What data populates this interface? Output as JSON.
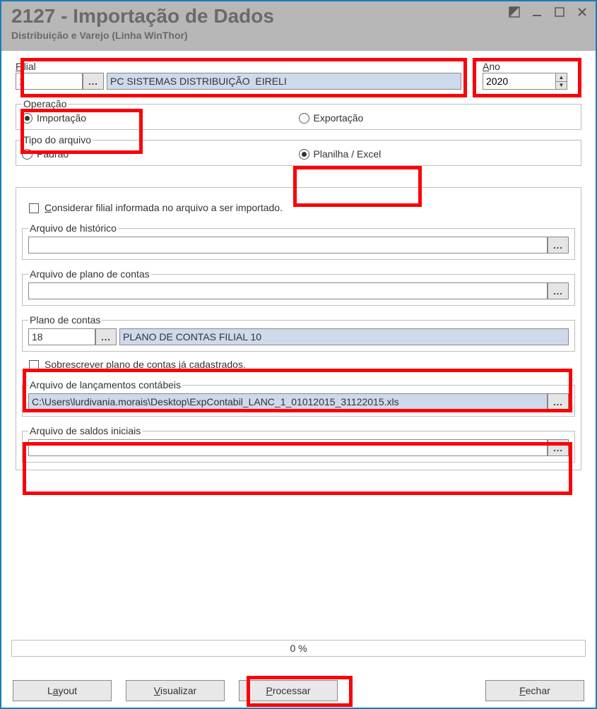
{
  "title": "2127 - Importação de Dados",
  "subtitle": "Distribuição e Varejo (Linha WinThor)",
  "filial": {
    "label": "Filial",
    "code": "1",
    "desc": "PC SISTEMAS DISTRIBUIÇÃO  EIRELI"
  },
  "ano": {
    "label": "Ano",
    "value": "2020"
  },
  "lookup_btn": "...",
  "operacao": {
    "legend": "Operação",
    "importacao": "Importação",
    "exportacao": "Exportação",
    "selected": "importacao"
  },
  "tipo_arquivo": {
    "legend": "Tipo do arquivo",
    "padrao": "Padrão",
    "planilha": "Planilha / Excel",
    "selected": "planilha"
  },
  "chk_considerar": "Considerar filial informada no arquivo a ser importado.",
  "arq_hist": {
    "legend": "Arquivo de histórico",
    "value": ""
  },
  "arq_plano": {
    "legend": "Arquivo de plano de contas",
    "value": ""
  },
  "plano_contas": {
    "legend": "Plano de contas",
    "code": "18",
    "desc": "PLANO DE CONTAS FILIAL 10"
  },
  "chk_sobrescrever_pre": "S",
  "chk_sobrescrever_u": "o",
  "chk_sobrescrever_post": "brescrever plano de contas já cadastrados.",
  "arq_lanc": {
    "legend": "Arquivo de lançamentos contábeis",
    "value": "C:\\Users\\lurdivania.morais\\Desktop\\ExpContabil_LANC_1_01012015_31122015.xls"
  },
  "arq_saldos": {
    "legend": "Arquivo de saldos iniciais",
    "value": ""
  },
  "progress": "0 %",
  "buttons": {
    "layout_pre": "L",
    "layout_u": "a",
    "layout_post": "yout",
    "visualizar_u": "V",
    "visualizar_post": "isualizar",
    "processar_u": "P",
    "processar_post": "rocessar",
    "fechar_u": "F",
    "fechar_post": "echar"
  }
}
